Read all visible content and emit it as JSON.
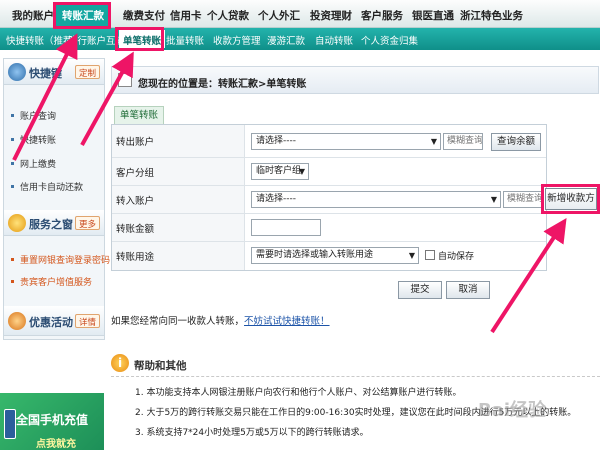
{
  "topnav": [
    "我的账户",
    "转账汇款",
    "缴费支付",
    "信用卡",
    "个人贷款",
    "个人外汇",
    "投资理财",
    "客户服务",
    "银医直通",
    "浙江特色业务"
  ],
  "subnav": [
    "快捷转账（推荐）",
    "跨行账户互转",
    "单笔转账",
    "批量转账",
    "收款方管理",
    "漫游汇款",
    "自动转账",
    "个人资金归集"
  ],
  "sidebar": {
    "quick": {
      "title": "快捷键",
      "btn": "定制",
      "links": [
        "账户查询",
        "快捷转账",
        "网上缴费",
        "信用卡自动还款"
      ]
    },
    "service": {
      "title": "服务之窗",
      "btn": "更多",
      "links": [
        "重置网银查询登录密码",
        "贵宾客户增值服务"
      ]
    },
    "promo": {
      "title": "优惠活动",
      "btn": "详情"
    }
  },
  "breadcrumb": "您现在的位置是：转账汇款>单笔转账",
  "tab": "单笔转账",
  "form": {
    "out_label": "转出账户",
    "out_select": "请选择----",
    "fuzzy_query": "模糊查询",
    "balance_btn": "查询余额",
    "group_label": "客户分组",
    "group_select": "临时客户组",
    "in_label": "转入账户",
    "in_select": "请选择----",
    "add_payee": "新增收款方",
    "amount_label": "转账金额",
    "amount_value": "",
    "purpose_label": "转账用途",
    "purpose_select": "需要时请选择或输入转账用途",
    "auto_save": "自动保存",
    "submit": "提交",
    "cancel": "取消"
  },
  "hint": {
    "text": "如果您经常向同一收款人转账，",
    "link": "不妨试试快捷转账！"
  },
  "help": {
    "title": "帮助和其他",
    "items": [
      "1. 本功能支持本人网银注册账户向农行和他行个人账户、对公结算账户进行转账。",
      "2. 大于5万的跨行转账交易只能在工作日的9:00-16:30实时处理，建议您在此时间段内进行5万元以上的转账。",
      "3. 系统支持7*24小时处理5万或5万以下的跨行转账请求。"
    ]
  },
  "ad": {
    "line1": "全国手机充值",
    "line2": "点我就充"
  },
  "watermark": "Bai经验",
  "colors": {
    "nav_active": "#12a6a0",
    "annotation": "#ee1566"
  }
}
